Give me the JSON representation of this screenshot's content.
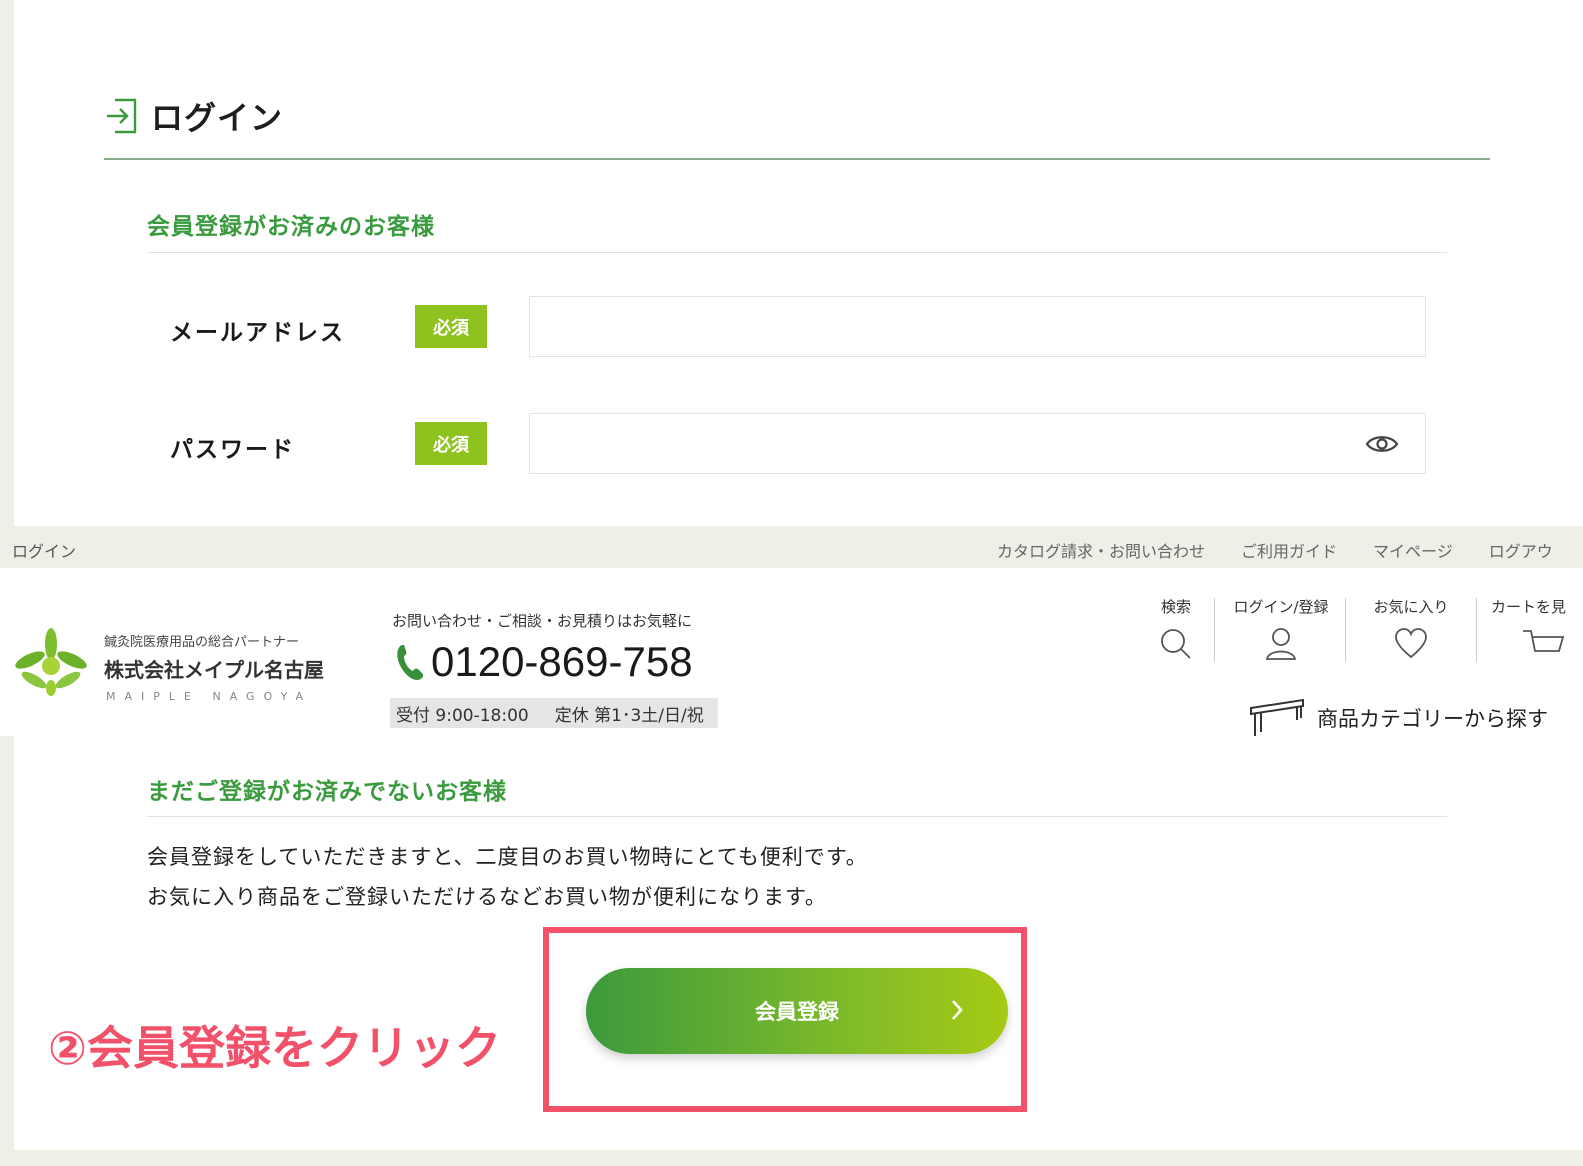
{
  "login": {
    "title": "ログイン",
    "member_section_title": "会員登録がお済みのお客様",
    "email_label": "メールアドレス",
    "password_label": "パスワード",
    "required_badge": "必須"
  },
  "topbar": {
    "breadcrumb": "ログイン",
    "links": [
      "カタログ請求・お問い合わせ",
      "ご利用ガイド",
      "マイページ",
      "ログアウ"
    ]
  },
  "header": {
    "logo_tagline": "鍼灸院医療用品の総合パートナー",
    "company_name": "株式会社メイプル名古屋",
    "company_en": "MAIPLE NAGOYA",
    "tel_intro": "お問い合わせ・ご相談・お見積りはお気軽に",
    "tel_number": "0120-869-758",
    "hours_open": "受付 9:00-18:00",
    "hours_closed": "定休 第1･3土/日/祝",
    "nav": {
      "search": "検索",
      "login": "ログイン/登録",
      "favorites": "お気に入り",
      "cart": "カートを見"
    },
    "category_button": "商品カテゴリーから探す"
  },
  "register": {
    "section_title": "まだご登録がお済みでないお客様",
    "desc_line1": "会員登録をしていただきますと、二度目のお買い物時にとても便利です。",
    "desc_line2": "お気に入り商品をご登録いただけるなどお買い物が便利になります。",
    "button_label": "会員登録"
  },
  "annotation": "②会員登録をクリック",
  "colors": {
    "accent_green": "#3a9a3e",
    "badge_green": "#8ec21f",
    "highlight_red": "#f2516a"
  }
}
